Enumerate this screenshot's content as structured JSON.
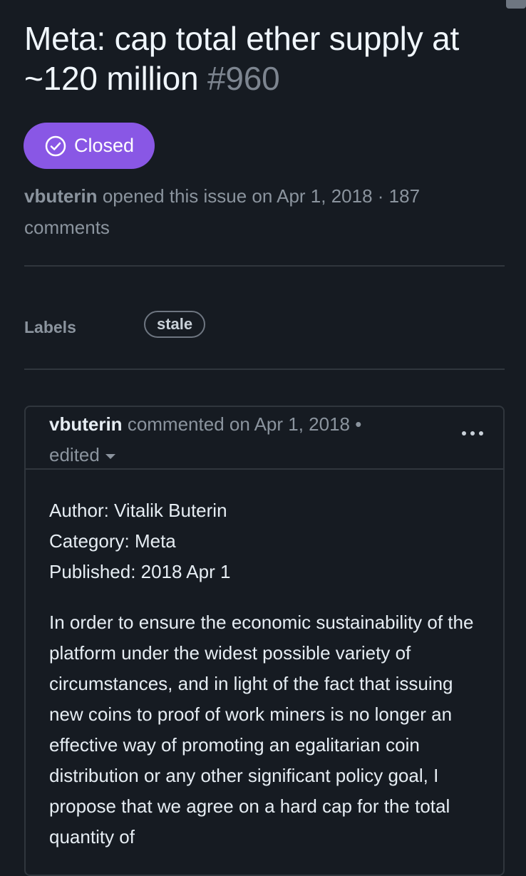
{
  "issue": {
    "title": "Meta: cap total ether supply at ~120 million",
    "number": "#960",
    "state": "Closed",
    "author": "vbuterin",
    "meta_text": "opened this issue on Apr 1, 2018 · 187 comments"
  },
  "labels": {
    "heading": "Labels",
    "items": [
      "stale"
    ]
  },
  "comment": {
    "author": "vbuterin",
    "meta_text": "commented on Apr 1, 2018 •",
    "edited_label": "edited",
    "preamble": {
      "author_line": "Author: Vitalik Buterin",
      "category_line": "Category: Meta",
      "published_line": "Published: 2018 Apr 1"
    },
    "body": "In order to ensure the economic sustainability of the platform under the widest possible variety of circumstances, and in light of the fact that issuing new coins to proof of work miners is no longer an effective way of promoting an egalitarian coin distribution or any other significant policy goal, I propose that we agree on a hard cap for the total quantity of"
  },
  "colors": {
    "background": "#161b22",
    "closed_badge": "#8957e5",
    "muted_text": "#8b949e",
    "border": "#30363d"
  },
  "icons": {
    "state": "check-circle-icon",
    "menu": "kebab-horizontal-icon",
    "dropdown": "triangle-down-icon"
  }
}
